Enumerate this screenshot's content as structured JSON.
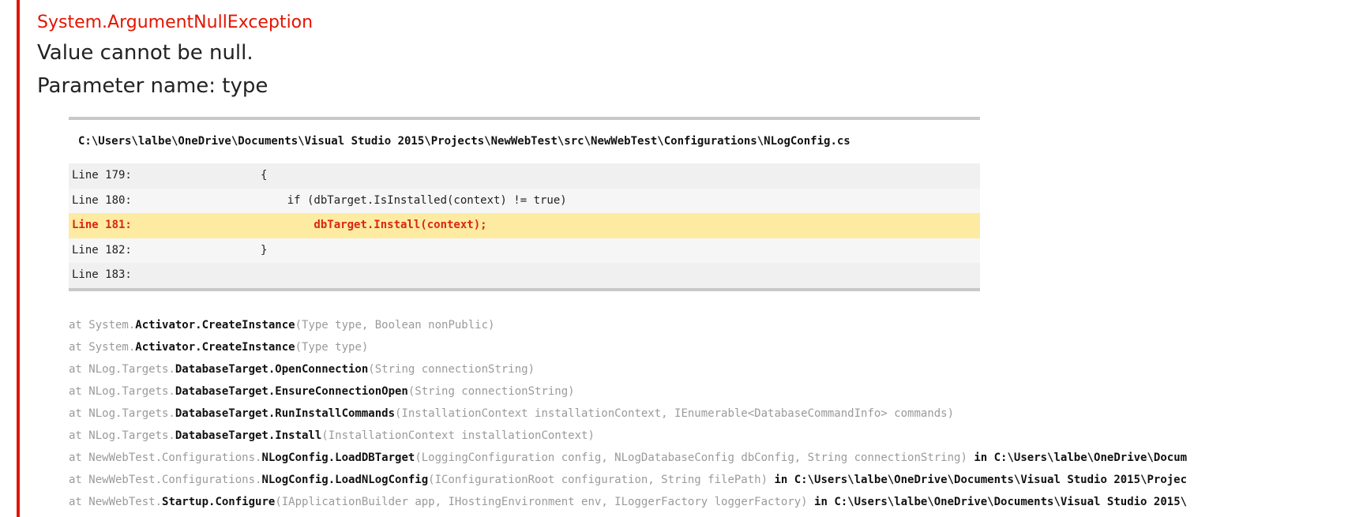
{
  "exception": {
    "type": "System.ArgumentNullException",
    "message_line1": "Value cannot be null.",
    "message_line2": "Parameter name: type"
  },
  "source": {
    "file_path": "C:\\Users\\lalbe\\OneDrive\\Documents\\Visual Studio 2015\\Projects\\NewWebTest\\src\\NewWebTest\\Configurations\\NLogConfig.cs",
    "lines": [
      {
        "label": "Line 179:",
        "code": "{"
      },
      {
        "label": "Line 180:",
        "code": "    if (dbTarget.IsInstalled(context) != true)"
      },
      {
        "label": "Line 181:",
        "code": "        dbTarget.Install(context);"
      },
      {
        "label": "Line 182:",
        "code": "}"
      },
      {
        "label": "Line 183:",
        "code": ""
      }
    ]
  },
  "stack": [
    {
      "prefix": "at System.",
      "method": "Activator.CreateInstance",
      "args": "(Type type, Boolean nonPublic)",
      "location": ""
    },
    {
      "prefix": "at System.",
      "method": "Activator.CreateInstance",
      "args": "(Type type)",
      "location": ""
    },
    {
      "prefix": "at NLog.Targets.",
      "method": "DatabaseTarget.OpenConnection",
      "args": "(String connectionString)",
      "location": ""
    },
    {
      "prefix": "at NLog.Targets.",
      "method": "DatabaseTarget.EnsureConnectionOpen",
      "args": "(String connectionString)",
      "location": ""
    },
    {
      "prefix": "at NLog.Targets.",
      "method": "DatabaseTarget.RunInstallCommands",
      "args": "(InstallationContext installationContext, IEnumerable<DatabaseCommandInfo> commands)",
      "location": ""
    },
    {
      "prefix": "at NLog.Targets.",
      "method": "DatabaseTarget.Install",
      "args": "(InstallationContext installationContext)",
      "location": ""
    },
    {
      "prefix": "at NewWebTest.Configurations.",
      "method": "NLogConfig.LoadDBTarget",
      "args": "(LoggingConfiguration config, NLogDatabaseConfig dbConfig, String connectionString)",
      "location": " in C:\\Users\\lalbe\\OneDrive\\Docum"
    },
    {
      "prefix": "at NewWebTest.Configurations.",
      "method": "NLogConfig.LoadNLogConfig",
      "args": "(IConfigurationRoot configuration, String filePath)",
      "location": " in C:\\Users\\lalbe\\OneDrive\\Documents\\Visual Studio 2015\\Projec"
    },
    {
      "prefix": "at NewWebTest.",
      "method": "Startup.Configure",
      "args": "(IApplicationBuilder app, IHostingEnvironment env, ILoggerFactory loggerFactory)",
      "location": " in C:\\Users\\lalbe\\OneDrive\\Documents\\Visual Studio 2015\\"
    }
  ]
}
